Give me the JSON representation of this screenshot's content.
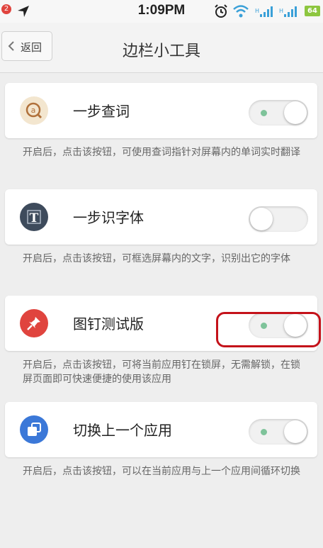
{
  "status_bar": {
    "notification_count": "2",
    "time": "1:09PM",
    "battery": "64"
  },
  "header": {
    "back_label": "返回",
    "title": "边栏小工具"
  },
  "tools": [
    {
      "label": "一步查词",
      "description": "开启后，点击该按钮，可使用查词指针对屏幕内的单词实时翻译",
      "enabled": true,
      "icon": "a-magnifier-icon",
      "icon_color": "#f3e6cf"
    },
    {
      "label": "一步识字体",
      "description": "开启后，点击该按钮，可框选屏幕内的文字，识别出它的字体",
      "enabled": false,
      "icon": "letter-t-icon",
      "icon_color": "#3e4b5c"
    },
    {
      "label": "图钉测试版",
      "description": "开启后，点击该按钮，可将当前应用钉在锁屏，无需解锁，在锁屏页面即可快速便捷的使用该应用",
      "enabled": true,
      "icon": "pushpin-icon",
      "icon_color": "#e0443e"
    },
    {
      "label": "切换上一个应用",
      "description": "开启后，点击该按钮，可以在当前应用与上一个应用间循环切换",
      "enabled": true,
      "icon": "switch-app-icon",
      "icon_color": "#3b78d8"
    }
  ],
  "colors": {
    "toggle_indicator": "#7ec39a",
    "highlight": "#c4121a"
  }
}
